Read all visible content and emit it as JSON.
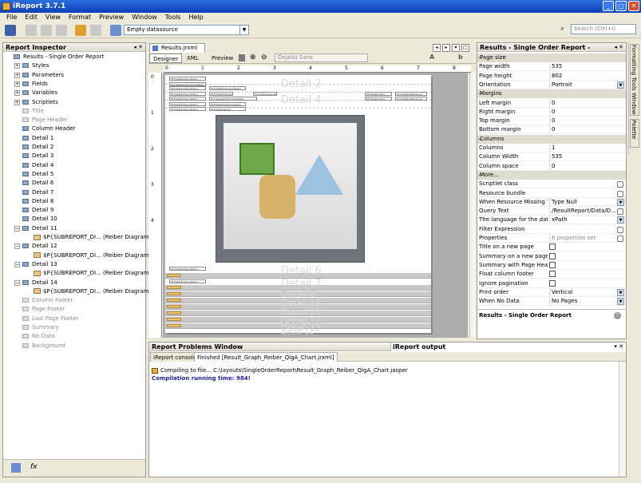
{
  "window": {
    "title": "iReport 3.7.1"
  },
  "menu": [
    "File",
    "Edit",
    "View",
    "Format",
    "Preview",
    "Window",
    "Tools",
    "Help"
  ],
  "toolbar": {
    "datasource": "Empty datasource",
    "search_placeholder": "Search (Ctrl+I)"
  },
  "inspector": {
    "title": "Report Inspector",
    "items": [
      {
        "label": "Results - Single Order Report",
        "gray": false
      },
      {
        "label": "Styles",
        "gray": false
      },
      {
        "label": "Parameters",
        "gray": false
      },
      {
        "label": "Fields",
        "gray": false
      },
      {
        "label": "Variables",
        "gray": false
      },
      {
        "label": "Scriptlets",
        "gray": false
      },
      {
        "label": "Title",
        "gray": true
      },
      {
        "label": "Page Header",
        "gray": true
      },
      {
        "label": "Column Header",
        "gray": false
      },
      {
        "label": "Detail 1",
        "gray": false
      },
      {
        "label": "Detail 2",
        "gray": false
      },
      {
        "label": "Detail 3",
        "gray": false
      },
      {
        "label": "Detail 4",
        "gray": false
      },
      {
        "label": "Detail 5",
        "gray": false
      },
      {
        "label": "Detail 6",
        "gray": false
      },
      {
        "label": "Detail 7",
        "gray": false
      },
      {
        "label": "Detail 8",
        "gray": false
      },
      {
        "label": "Detail 9",
        "gray": false
      },
      {
        "label": "Detail 10",
        "gray": false
      },
      {
        "label": "Detail 11",
        "gray": false
      },
      {
        "label": "$P{SUBREPORT_DI... (Reiber Diagram)",
        "gray": false
      },
      {
        "label": "Detail 12",
        "gray": false
      },
      {
        "label": "$P{SUBREPORT_DI... (Reiber Diagram)",
        "gray": false
      },
      {
        "label": "Detail 13",
        "gray": false
      },
      {
        "label": "$P{SUBREPORT_DI... (Reiber Diagram)",
        "gray": false
      },
      {
        "label": "Detail 14",
        "gray": false
      },
      {
        "label": "$P{SUBREPORT_DI... (Reiber Diagram)",
        "gray": false
      },
      {
        "label": "Column Footer",
        "gray": true
      },
      {
        "label": "Page Footer",
        "gray": true
      },
      {
        "label": "Last Page Footer",
        "gray": true
      },
      {
        "label": "Summary",
        "gray": true
      },
      {
        "label": "No Data",
        "gray": true
      },
      {
        "label": "Background",
        "gray": true
      }
    ]
  },
  "editor": {
    "tab": "Results.jrxml",
    "designer_tabs": [
      "Designer",
      "XML",
      "Preview"
    ],
    "font": "DejaVu Sans",
    "ruler": [
      "0",
      "1",
      "2",
      "3",
      "4",
      "5",
      "6",
      "7",
      "8"
    ],
    "vruler": [
      "0",
      "1",
      "2",
      "3",
      "4"
    ],
    "band_labels": [
      "Detail 2",
      "Detail 4",
      "Detail 6",
      "Detail 7",
      "Detail 8",
      "Detail 10",
      "Detail 11",
      "Detail 12",
      "Detail 13",
      "Detail 14"
    ],
    "field_desc": "$F{Detail.Description}",
    "field_prev": "$F{Detail.PreviousValue}",
    "field_val": "$F{Detail.Value}",
    "field_comm": "$V{ValueAndCommentRef}",
    "field_unit": "$F{Detail.Unit}",
    "field_ref": "$F{Detail.Reference}"
  },
  "properties": {
    "title": "Results - Single Order Report - Properties",
    "rows": [
      {
        "type": "section",
        "k": "Page size"
      },
      {
        "k": "Page width",
        "v": "535"
      },
      {
        "k": "Page height",
        "v": "802"
      },
      {
        "k": "Orientation",
        "v": "Portrait",
        "dd": true
      },
      {
        "type": "section",
        "k": "Margins"
      },
      {
        "k": "Left margin",
        "v": "0"
      },
      {
        "k": "Right margin",
        "v": "0"
      },
      {
        "k": "Top margin",
        "v": "0"
      },
      {
        "k": "Bottom margin",
        "v": "0"
      },
      {
        "type": "section",
        "k": "Columns"
      },
      {
        "k": "Columns",
        "v": "1"
      },
      {
        "k": "Column Width",
        "v": "535"
      },
      {
        "k": "Column space",
        "v": "0"
      },
      {
        "type": "section",
        "k": "More..."
      },
      {
        "k": "Scriptlet class",
        "v": "",
        "btn": true
      },
      {
        "k": "Resource bundle",
        "v": "",
        "btn": true
      },
      {
        "k": "When Resource Missing Type",
        "v": "Type Null",
        "dd": true
      },
      {
        "k": "Query Text",
        "v": "/ResultReport/Data/D...",
        "btn": true
      },
      {
        "k": "The language for the dataset",
        "v": "xPath",
        "dd": true
      },
      {
        "k": "Filter Expression",
        "v": "",
        "btn": true
      },
      {
        "k": "Properties",
        "v": "6 properties set",
        "gray": true,
        "btn": true
      },
      {
        "k": "Title on a new page",
        "chk": true
      },
      {
        "k": "Summary on a new page",
        "chk": true
      },
      {
        "k": "Summary with Page Header",
        "chk": true
      },
      {
        "k": "Float column footer",
        "chk": true
      },
      {
        "k": "Ignore pagination",
        "chk": true
      },
      {
        "k": "Print order",
        "v": "Vertical",
        "dd": true
      },
      {
        "k": "When No Data",
        "v": "No Pages",
        "dd": true
      }
    ],
    "footer": "Results - Single Order Report"
  },
  "sidetabs": [
    "Formatting Tools Window",
    "Palette"
  ],
  "bottom": {
    "left_title": "Report Problems Window",
    "right_title": "iReport output",
    "tabs": [
      "iReport console",
      "Finished [Result_Graph_Reiber_QlgA_Chart.jrxml]"
    ],
    "line1": "Compiling to file... C:\\layouts\\SingleOrderReport\\Result_Graph_Reiber_QlgA_Chart.jasper",
    "line2": "Compilation running time: 984!"
  }
}
